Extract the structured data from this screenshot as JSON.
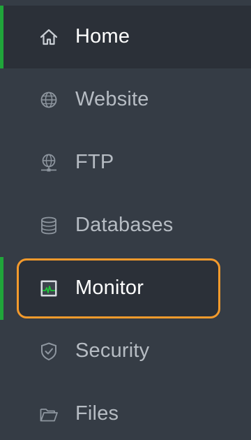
{
  "sidebar": {
    "items": [
      {
        "label": "Home",
        "icon": "home-icon",
        "active": true
      },
      {
        "label": "Website",
        "icon": "globe-icon",
        "active": false
      },
      {
        "label": "FTP",
        "icon": "ftp-globe-icon",
        "active": false
      },
      {
        "label": "Databases",
        "icon": "database-icon",
        "active": false
      },
      {
        "label": "Monitor",
        "icon": "monitor-icon",
        "active": false,
        "highlighted": true
      },
      {
        "label": "Security",
        "icon": "shield-icon",
        "active": false
      },
      {
        "label": "Files",
        "icon": "folder-icon",
        "active": false
      }
    ]
  },
  "colors": {
    "background": "#353c45",
    "active_background": "#2b3038",
    "accent": "#20a53a",
    "highlight_border": "#f39a2c",
    "label": "#b6bcc3",
    "active_label": "#ffffff"
  }
}
